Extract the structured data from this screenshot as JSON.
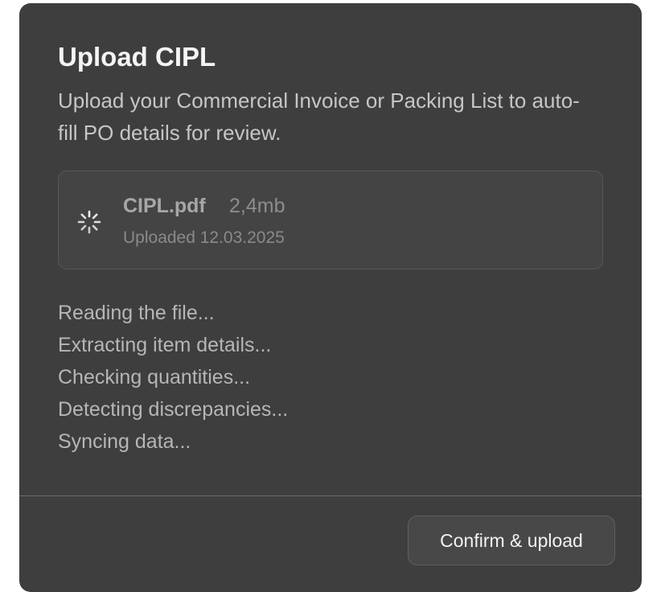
{
  "dialog": {
    "title": "Upload CIPL",
    "subtitle": "Upload your Commercial Invoice or Packing List to auto-fill PO details for review."
  },
  "file": {
    "name": "CIPL.pdf",
    "size": "2,4mb",
    "uploaded": "Uploaded 12.03.2025",
    "status_icon": "loading-spinner-icon"
  },
  "steps": [
    "Reading the file...",
    "Extracting item details...",
    "Checking quantities...",
    "Detecting discrepancies...",
    "Syncing data..."
  ],
  "footer": {
    "confirm_label": "Confirm & upload"
  },
  "colors": {
    "dialog_background": "#3e3e3e",
    "card_background": "#444444",
    "text_primary": "#f4f4f4",
    "text_secondary": "#c6c6c6"
  }
}
